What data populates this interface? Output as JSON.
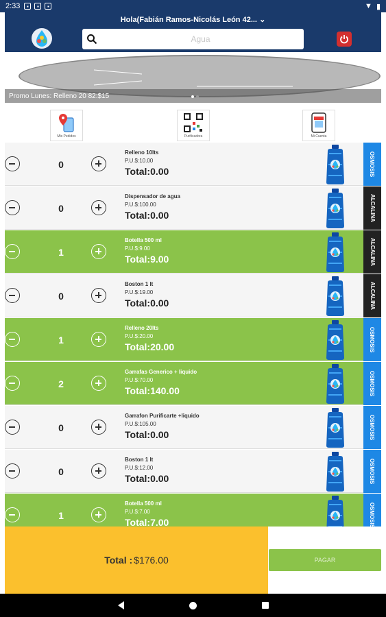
{
  "status_bar": {
    "time": "2:33"
  },
  "header": {
    "user_label": "Hola(Fabián Ramos-Nicolás León 42...",
    "search_placeholder": "Agua"
  },
  "banner": {
    "promo_text": "Promo Lunes: Relleno 20 82:$15"
  },
  "shortcuts": [
    {
      "label": "Mis Pedidos",
      "icon": "location-phone-icon"
    },
    {
      "label": "Purificadora",
      "icon": "qr-code-icon"
    },
    {
      "label": "Mi Cuenta",
      "icon": "store-phone-icon"
    }
  ],
  "products": [
    {
      "qty": "0",
      "name": "Relleno 10lts",
      "price": "P.U.$:10.00",
      "total": "Total:0.00",
      "tag": "OSMOSIS",
      "tag_color": "#1e88e5",
      "selected": false
    },
    {
      "qty": "0",
      "name": "Dispensador de agua",
      "price": "P.U.$:100.00",
      "total": "Total:0.00",
      "tag": "ALCALINA",
      "tag_color": "#222222",
      "selected": false
    },
    {
      "qty": "1",
      "name": "Botella 500 ml",
      "price": "P.U.$:9.00",
      "total": "Total:9.00",
      "tag": "ALCALINA",
      "tag_color": "#222222",
      "selected": true
    },
    {
      "qty": "0",
      "name": "Boston 1 lt",
      "price": "P.U.$:19.00",
      "total": "Total:0.00",
      "tag": "ALCALINA",
      "tag_color": "#222222",
      "selected": false
    },
    {
      "qty": "1",
      "name": "Relleno 20lts",
      "price": "P.U.$:20.00",
      "total": "Total:20.00",
      "tag": "OSMOSIS",
      "tag_color": "#1e88e5",
      "selected": true
    },
    {
      "qty": "2",
      "name": "Garrafas Generico + liquido",
      "price": "P.U.$:70.00",
      "total": "Total:140.00",
      "tag": "OSMOSIS",
      "tag_color": "#1e88e5",
      "selected": true
    },
    {
      "qty": "0",
      "name": "Garrafon Purificarte +liquido",
      "price": "P.U.$:105.00",
      "total": "Total:0.00",
      "tag": "OSMOSIS",
      "tag_color": "#1e88e5",
      "selected": false
    },
    {
      "qty": "0",
      "name": "Boston 1 lt",
      "price": "P.U.$:12.00",
      "total": "Total:0.00",
      "tag": "OSMOSIS",
      "tag_color": "#1e88e5",
      "selected": false
    },
    {
      "qty": "1",
      "name": "Botella 500 ml",
      "price": "P.U.$:7.00",
      "total": "Total:7.00",
      "tag": "OSMOSIS",
      "tag_color": "#1e88e5",
      "selected": true
    }
  ],
  "footer": {
    "total_label": "Total :",
    "total_value": "$176.00",
    "pay_label": "PAGAR"
  },
  "colors": {
    "primary": "#1a3a6b",
    "selected_row": "#8bc34a",
    "total_box": "#fbc02d",
    "power": "#d32f2f"
  }
}
